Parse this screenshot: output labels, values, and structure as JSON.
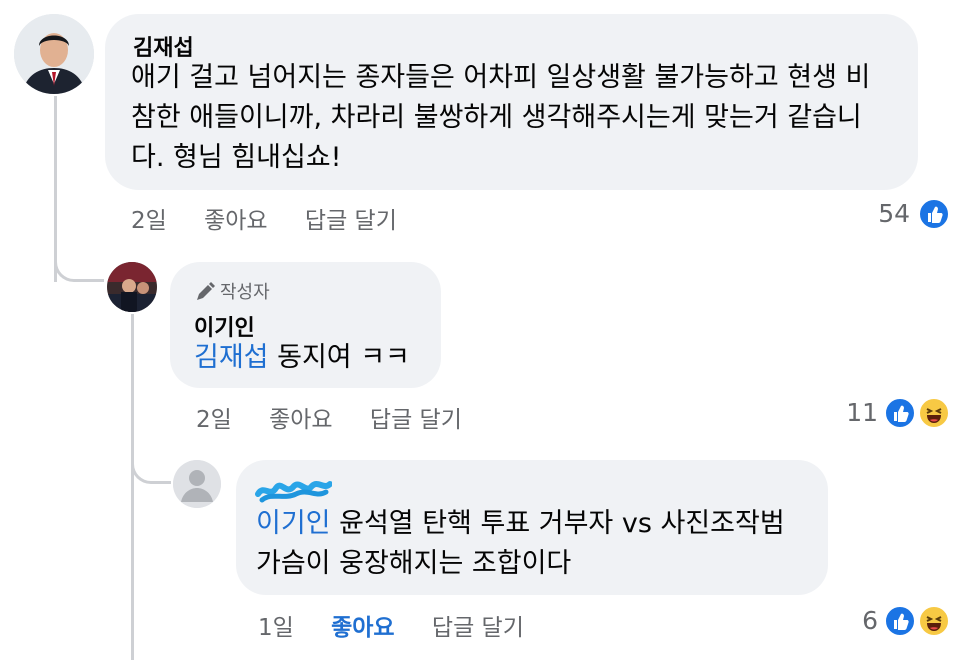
{
  "comments": [
    {
      "author": "김재섭",
      "lines": [
        "애기 걸고 넘어지는 종자들은 어차피 일상생활 불가능하고 현생 비",
        "참한 애들이니까, 차라리 불쌍하게 생각해주시는게 맞는거 같습니",
        "다. 형님 힘내십쇼!"
      ],
      "time": "2일",
      "like_label": "좋아요",
      "reply_label": "답글 달기",
      "reaction_count": "54"
    },
    {
      "badge": "작성자",
      "author": "이기인",
      "mention": "김재섭",
      "text": " 동지여 ㅋㅋ",
      "time": "2일",
      "like_label": "좋아요",
      "reply_label": "답글 달기",
      "reaction_count": "11"
    },
    {
      "mention": "이기인",
      "line1": " 윤석열 탄핵 투표 거부자 vs 사진조작범",
      "line2": "가슴이 웅장해지는 조합이다",
      "time": "1일",
      "like_label": "좋아요",
      "reply_label": "답글 달기",
      "reaction_count": "6"
    }
  ],
  "colors": {
    "bubble": "#f0f2f5",
    "mention": "#1f6fd1",
    "meta": "#65676b",
    "like": "#1b74e4",
    "haha": "#f7c944"
  },
  "icons": [
    "like-icon",
    "haha-icon",
    "pen-icon",
    "default-avatar-icon"
  ]
}
